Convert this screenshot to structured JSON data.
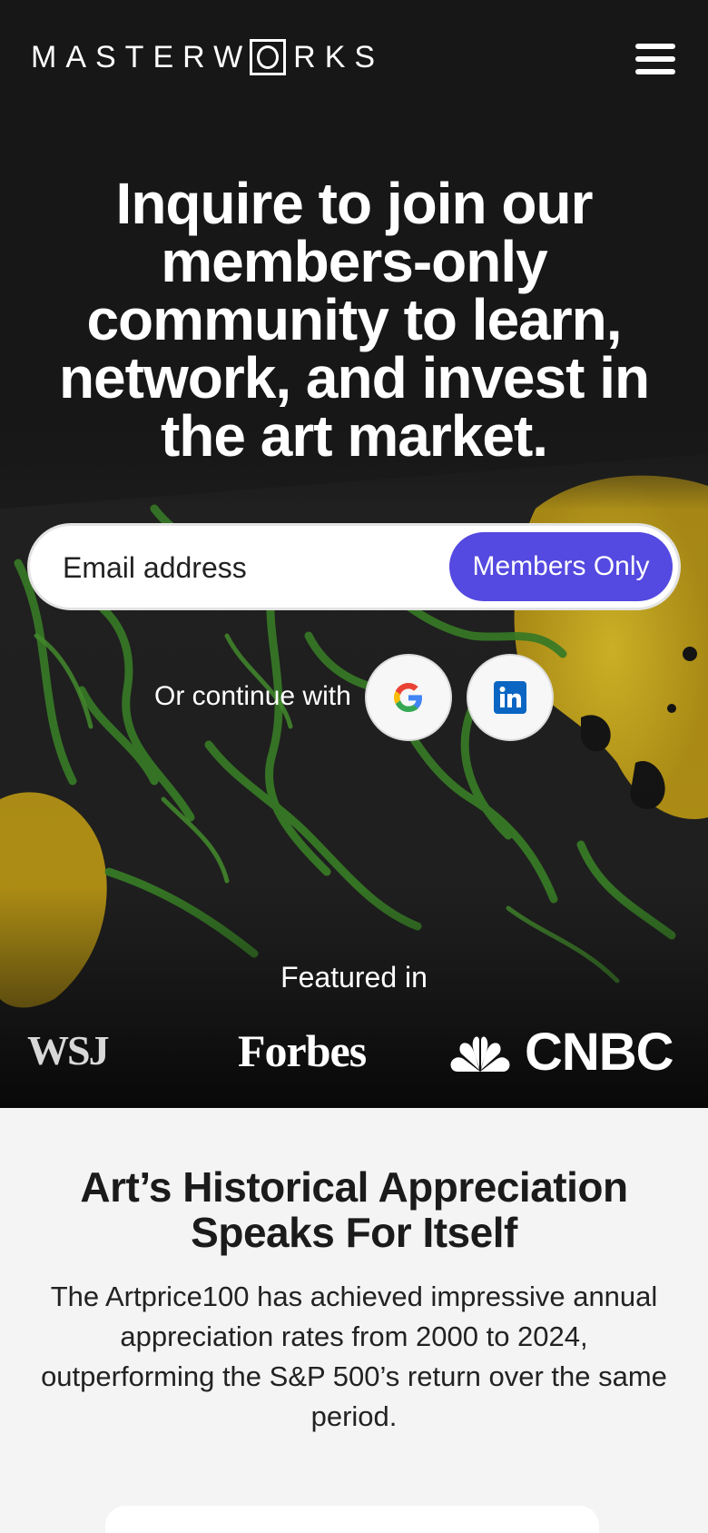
{
  "header": {
    "logo_left": "MASTERW",
    "logo_right": "RKS",
    "menu_icon": "hamburger-menu-icon"
  },
  "hero": {
    "headline": "Inquire to join our members-only community to learn, network, and invest in the art market.",
    "email_placeholder": "Email address",
    "members_button": "Members Only",
    "continue_label": "Or continue with",
    "social_icons": [
      "google-icon",
      "linkedin-icon"
    ],
    "featured_label": "Featured in",
    "press": {
      "wsj": "WSJ",
      "forbes": "Forbes",
      "cnbc": "CNBC"
    }
  },
  "section": {
    "title": "Art’s Historical Appreciation Speaks For Itself",
    "body": "The Artprice100 has achieved impressive annual appreciation rates from 2000 to 2024, outperforming the S&P 500’s return over the same period."
  },
  "colors": {
    "accent": "#5449e0",
    "hero_bg": "#171717",
    "section_bg": "#f4f4f4",
    "art_green": "#3f8f2a",
    "art_yellow": "#e9c421"
  }
}
